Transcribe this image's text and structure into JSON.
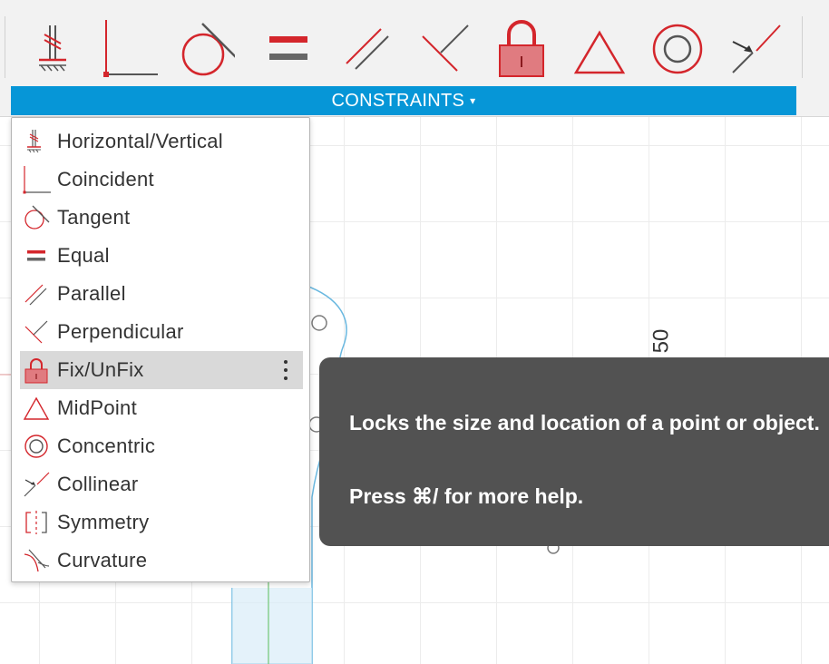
{
  "ribbon": {
    "label": "CONSTRAINTS",
    "caret": "▾"
  },
  "toolbar": {
    "icons": [
      "horizontal-vertical-icon",
      "coincident-icon",
      "tangent-icon",
      "equal-icon",
      "parallel-icon",
      "perpendicular-icon",
      "fix-unfix-lock-icon",
      "midpoint-icon",
      "concentric-icon",
      "collinear-icon"
    ]
  },
  "menu": {
    "items": [
      {
        "label": "Horizontal/Vertical",
        "icon": "horizontal-vertical-icon"
      },
      {
        "label": "Coincident",
        "icon": "coincident-icon"
      },
      {
        "label": "Tangent",
        "icon": "tangent-icon"
      },
      {
        "label": "Equal",
        "icon": "equal-icon"
      },
      {
        "label": "Parallel",
        "icon": "parallel-icon"
      },
      {
        "label": "Perpendicular",
        "icon": "perpendicular-icon"
      },
      {
        "label": "Fix/UnFix",
        "icon": "lock-icon",
        "active": true
      },
      {
        "label": "MidPoint",
        "icon": "midpoint-icon"
      },
      {
        "label": "Concentric",
        "icon": "concentric-icon"
      },
      {
        "label": "Collinear",
        "icon": "collinear-icon"
      },
      {
        "label": "Symmetry",
        "icon": "symmetry-icon"
      },
      {
        "label": "Curvature",
        "icon": "curvature-icon"
      }
    ]
  },
  "tooltip": {
    "description": "Locks the size and location of a point or object.",
    "help": "Press ⌘/ for more help."
  },
  "canvas": {
    "dimension_label": "50"
  },
  "colors": {
    "accent": "#0696d7",
    "constraint_red": "#d4262c",
    "tooltip_bg": "#525252",
    "menu_highlight": "#d9d9d9"
  }
}
